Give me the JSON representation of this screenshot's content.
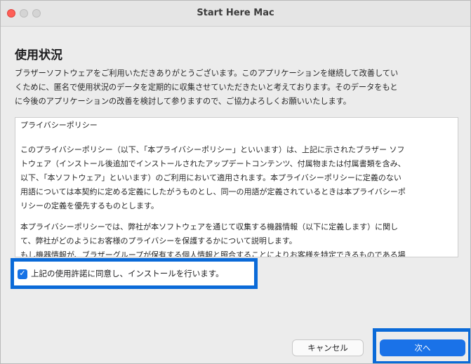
{
  "window": {
    "title": "Start Here Mac"
  },
  "page": {
    "heading": "使用状況",
    "intro": "ブラザーソフトウェアをご利用いただきありがとうございます。このアプリケーションを継続して改善してい\nくために、匿名で使用状況のデータを定期的に収集させていただきたいと考えております。そのデータをもと\nに今後のアプリケーションの改善を検討して参りますので、ご協力よろしくお願いいたします。"
  },
  "policy": {
    "title": "プライバシーポリシー",
    "para1": "このプライバシーポリシー（以下、「本プライバシーポリシー」といいます）は、上記に示されたブラザー ソフ\nトウェア（インストール後追加でインストールされたアップデートコンテンツ、付属物または付属書類を含み、\n以下、「本ソフトウェア」といいます）のご利用において適用されます。本プライバシーポリシーに定義のない\n用語については本契約に定める定義にしたがうものとし、同一の用語が定義されているときは本プライバシーポ\nリシーの定義を優先するものとします。",
    "para2": "本プライバシーポリシーでは、弊社が本ソフトウェアを通じて収集する機器情報（以下に定義します）に関し\nて、弊社がどのようにお客様のプライバシーを保護するかについて説明します。\nもし機器情報が、ブラザーグループが保有する個人情報と照合することによりお客様を特定できるものである場"
  },
  "consent": {
    "checked": true,
    "label": "上記の使用許諾に同意し、インストールを行います。"
  },
  "buttons": {
    "cancel": "キャンセル",
    "next": "次へ"
  },
  "colors": {
    "accent": "#1a72e8",
    "highlight": "#0a6ad8",
    "close": "#fe5f57"
  }
}
